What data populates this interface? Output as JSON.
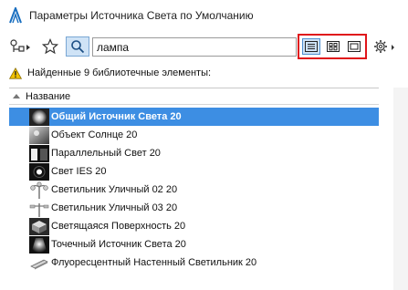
{
  "window": {
    "title": "Параметры Источника Света по Умолчанию"
  },
  "toolbar": {
    "search_value": "лампа"
  },
  "status": {
    "found_text": "Найденные 9 библиотечные элементы:"
  },
  "list": {
    "column_header": "Название",
    "items": [
      {
        "label": "Общий Источник Света 20",
        "icon": "light-sphere-icon",
        "selected": true
      },
      {
        "label": "Объект Солнце 20",
        "icon": "sun-object-icon",
        "selected": false
      },
      {
        "label": "Параллельный Свет 20",
        "icon": "parallel-light-icon",
        "selected": false
      },
      {
        "label": "Свет IES 20",
        "icon": "ies-light-icon",
        "selected": false
      },
      {
        "label": "Светильник Уличный 02 20",
        "icon": "street-lamp-02-icon",
        "selected": false
      },
      {
        "label": "Светильник Уличный 03 20",
        "icon": "street-lamp-03-icon",
        "selected": false
      },
      {
        "label": "Светящаяся Поверхность 20",
        "icon": "glowing-surface-icon",
        "selected": false
      },
      {
        "label": "Точечный Источник Света 20",
        "icon": "spot-light-icon",
        "selected": false
      },
      {
        "label": "Флуоресцентный Настенный Светильник 20",
        "icon": "fluorescent-lamp-icon",
        "selected": false
      }
    ]
  },
  "colors": {
    "selection": "#3d8ee3",
    "highlight_border": "#e0151b",
    "warning": "#f2c200"
  }
}
